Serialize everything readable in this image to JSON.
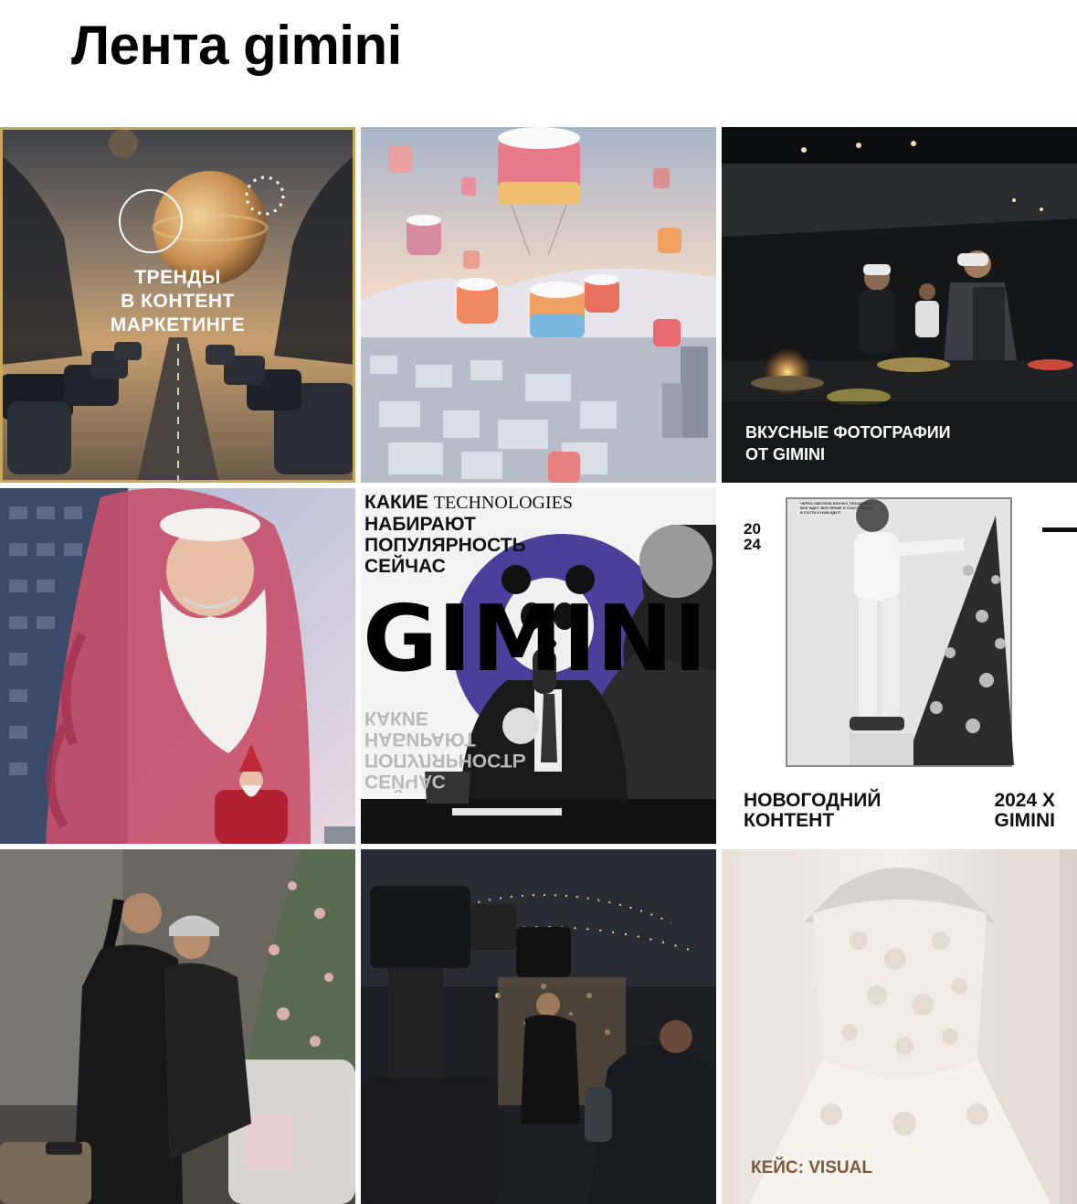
{
  "header": {
    "title": "Лента gimini"
  },
  "feed": {
    "tile_1": {
      "caption": "ТРЕНДЫ\nВ КОНТЕНТ\nМАРКЕТИНГЕ"
    },
    "tile_2": {},
    "tile_3": {
      "caption": "ВКУСНЫЕ ФОТОГРАФИИ\nОТ GIMINI"
    },
    "tile_4": {},
    "tile_5": {
      "caption_line1_a": "КАКИЕ ",
      "caption_line1_b": "TECHNOLOGIES",
      "caption_rest": "НАБИРАЮТ\nПОПУЛЯРНОСТЬ\nСЕЙЧАС",
      "big_text": "GIMINI",
      "mirror_text": "СЕЙЧАС\nПОПУЛЯРНОСТЬ\nНАБИРАЮТ\nКАКИЕ"
    },
    "tile_6": {
      "year": "20\n24",
      "small_text": "ЧЕРЕЗ СВЕТЛУЮ ЕЛОЧКУ, ПРАЗДНИКИ ВСЕ ЖДУТ, ВСЕ ЯРКИЕ И СЧАСТЛИВЫЕ В ГОСТИ К НАМ ИДУТ!",
      "left_caption": "НОВОГОДНИЙ\nКОНТЕНТ",
      "right_caption": "2024 X\nGIMINI"
    },
    "tile_7": {},
    "tile_8": {},
    "tile_9": {
      "caption": "КЕЙС: VISUAL"
    }
  },
  "colors": {
    "accent_gold": "#c9a85c",
    "purple_circle": "#4b3f9a"
  }
}
